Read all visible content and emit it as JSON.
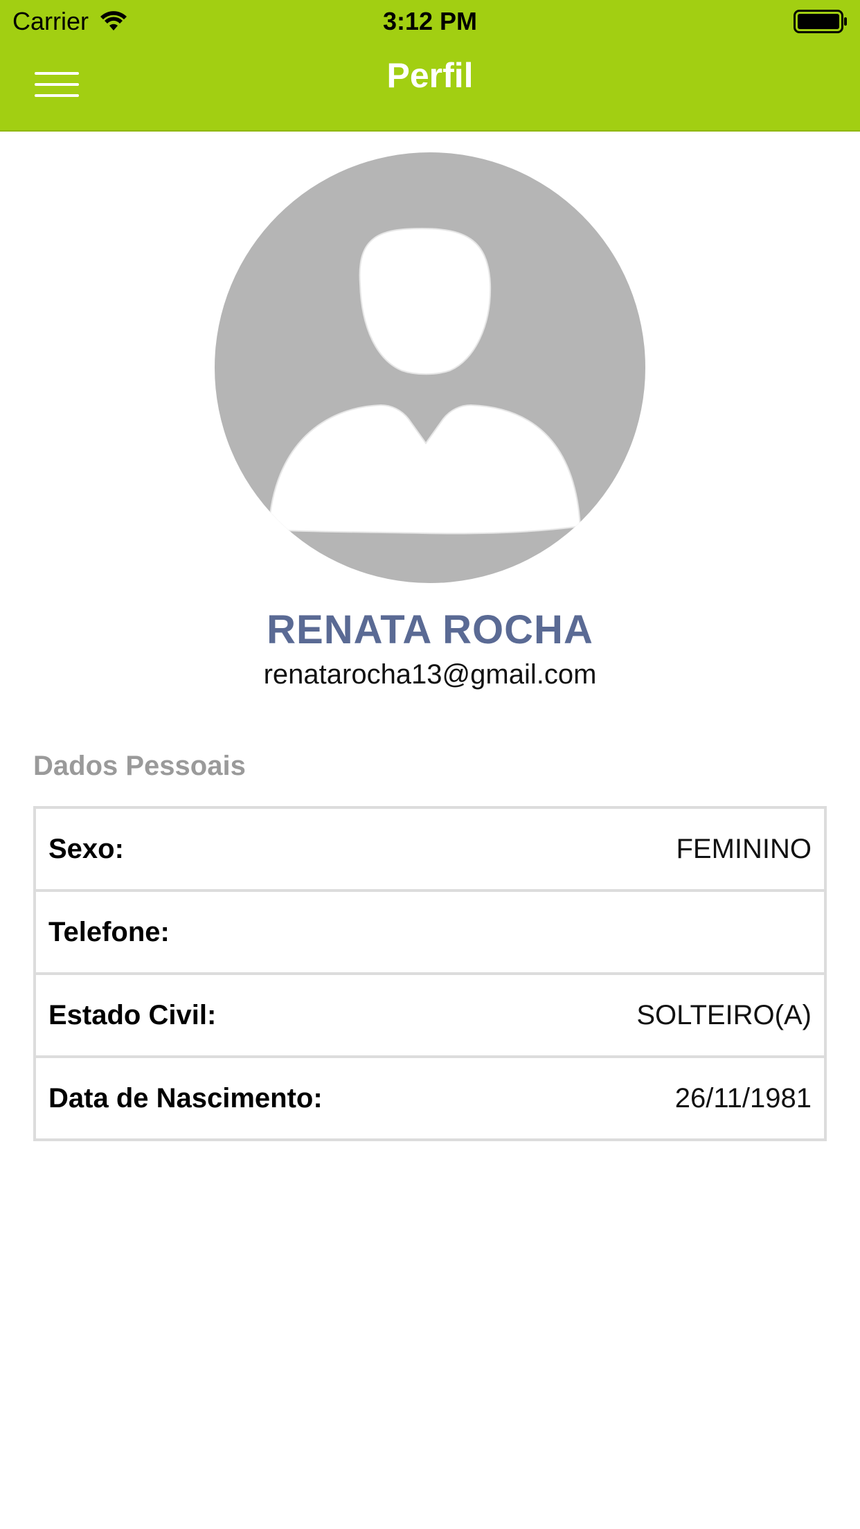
{
  "status_bar": {
    "carrier": "Carrier",
    "time": "3:12 PM"
  },
  "header": {
    "title": "Perfil",
    "background_color": "#a2cf12"
  },
  "profile": {
    "name": "RENATA ROCHA",
    "email": "renatarocha13@gmail.com",
    "name_color": "#5a6a94"
  },
  "personal_data": {
    "section_title": "Dados Pessoais",
    "rows": [
      {
        "label": "Sexo:",
        "value": "FEMININO"
      },
      {
        "label": "Telefone:",
        "value": ""
      },
      {
        "label": "Estado Civil:",
        "value": "SOLTEIRO(A)"
      },
      {
        "label": "Data de Nascimento:",
        "value": "26/11/1981"
      }
    ]
  },
  "icons": {
    "menu": "menu-icon",
    "wifi": "wifi-icon",
    "battery": "battery-icon",
    "avatar": "avatar-placeholder-icon"
  }
}
